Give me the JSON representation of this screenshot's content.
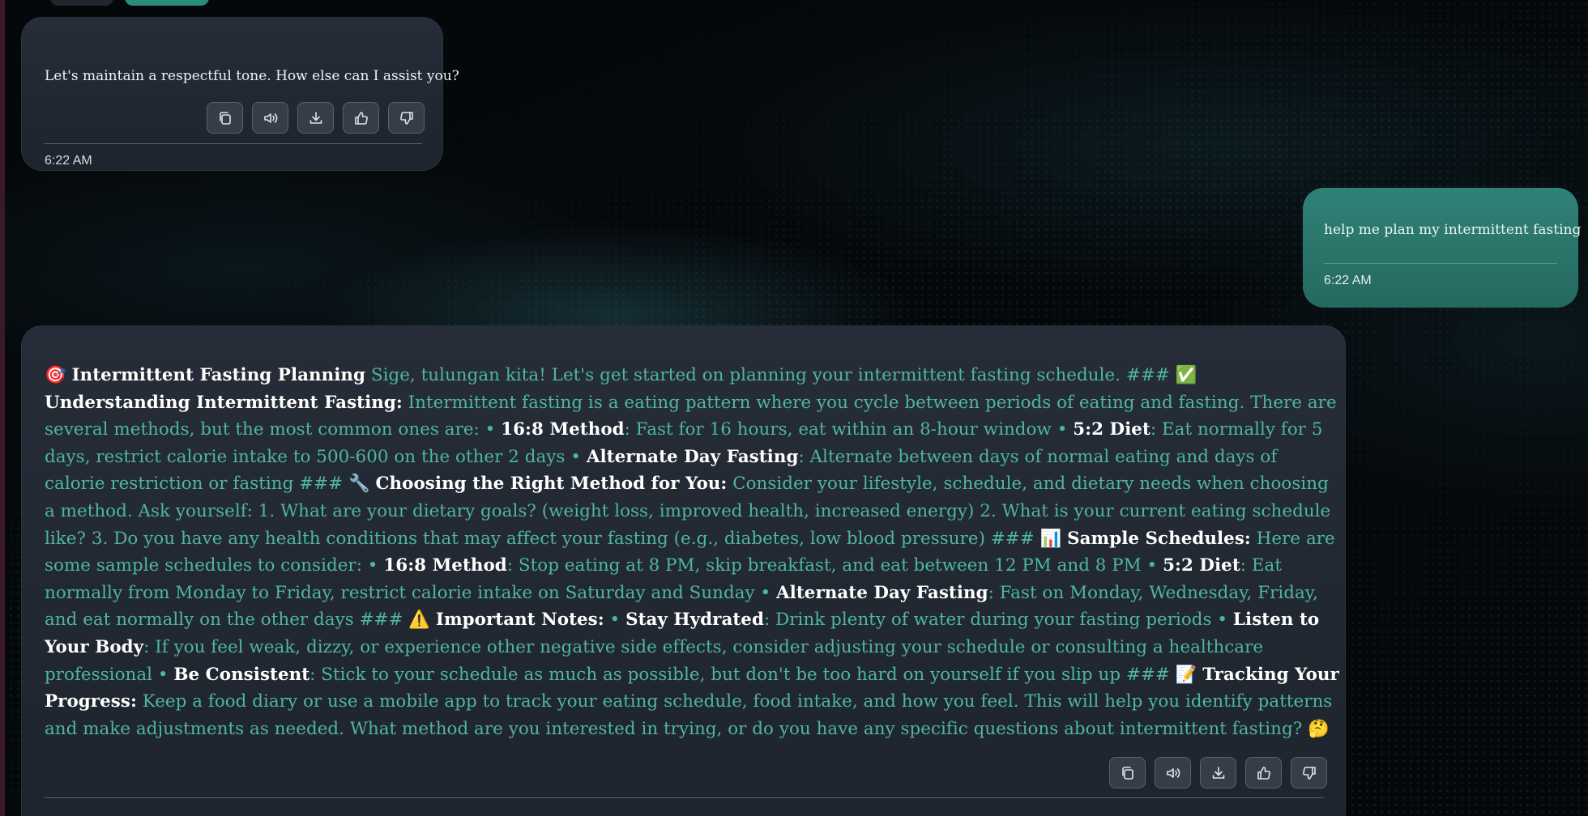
{
  "messages": [
    {
      "role": "assistant",
      "text": "Let's maintain a respectful tone. How else can I assist you?",
      "time": "6:22 AM"
    },
    {
      "role": "user",
      "text": "help me plan my intermittent fasting",
      "time": "6:22 AM"
    },
    {
      "role": "assistant",
      "time": "",
      "segments": [
        {
          "t": "🎯 "
        },
        {
          "t": "Intermittent Fasting Planning",
          "b": true
        },
        {
          "t": " Sige, tulungan kita! Let's get started on planning your intermittent fasting schedule. ### ✅ "
        },
        {
          "t": "Understanding Intermittent Fasting:",
          "b": true
        },
        {
          "t": " Intermittent fasting is a eating pattern where you cycle between periods of eating and fasting. There are several methods, but the most common ones are: • "
        },
        {
          "t": "16:8 Method",
          "b": true
        },
        {
          "t": ": Fast for 16 hours, eat within an 8-hour window • "
        },
        {
          "t": "5:2 Diet",
          "b": true
        },
        {
          "t": ": Eat normally for 5 days, restrict calorie intake to 500-600 on the other 2 days • "
        },
        {
          "t": "Alternate Day Fasting",
          "b": true
        },
        {
          "t": ": Alternate between days of normal eating and days of calorie restriction or fasting ### 🔧 "
        },
        {
          "t": "Choosing the Right Method for You:",
          "b": true
        },
        {
          "t": " Consider your lifestyle, schedule, and dietary needs when choosing a method. Ask yourself: 1. What are your dietary goals? (weight loss, improved health, increased energy) 2. What is your current eating schedule like? 3. Do you have any health conditions that may affect your fasting (e.g., diabetes, low blood pressure) ### 📊 "
        },
        {
          "t": "Sample Schedules:",
          "b": true
        },
        {
          "t": " Here are some sample schedules to consider: • "
        },
        {
          "t": "16:8 Method",
          "b": true
        },
        {
          "t": ": Stop eating at 8 PM, skip breakfast, and eat between 12 PM and 8 PM • "
        },
        {
          "t": "5:2 Diet",
          "b": true
        },
        {
          "t": ": Eat normally from Monday to Friday, restrict calorie intake on Saturday and Sunday • "
        },
        {
          "t": "Alternate Day Fasting",
          "b": true
        },
        {
          "t": ": Fast on Monday, Wednesday, Friday, and eat normally on the other days ### ⚠️ "
        },
        {
          "t": "Important Notes:",
          "b": true
        },
        {
          "t": " • "
        },
        {
          "t": "Stay Hydrated",
          "b": true
        },
        {
          "t": ": Drink plenty of water during your fasting periods • "
        },
        {
          "t": "Listen to Your Body",
          "b": true
        },
        {
          "t": ": If you feel weak, dizzy, or experience other negative side effects, consider adjusting your schedule or consulting a healthcare professional • "
        },
        {
          "t": "Be Consistent",
          "b": true
        },
        {
          "t": ": Stick to your schedule as much as possible, but don't be too hard on yourself if you slip up ### 📝 "
        },
        {
          "t": "Tracking Your Progress:",
          "b": true
        },
        {
          "t": " Keep a food diary or use a mobile app to track your eating schedule, food intake, and how you feel. This will help you identify patterns and make adjustments as needed. What method are you interested in trying, or do you have any specific questions about intermittent fasting? 🤔"
        }
      ]
    }
  ],
  "action_icons": [
    "copy-icon",
    "speaker-icon",
    "download-icon",
    "thumbs-up-icon",
    "thumbs-down-icon"
  ],
  "colors": {
    "assistant_bubble": "#262d38",
    "user_bubble": "#2f8276",
    "assistant_text": "#4fb5a2",
    "background": "#05080b"
  }
}
